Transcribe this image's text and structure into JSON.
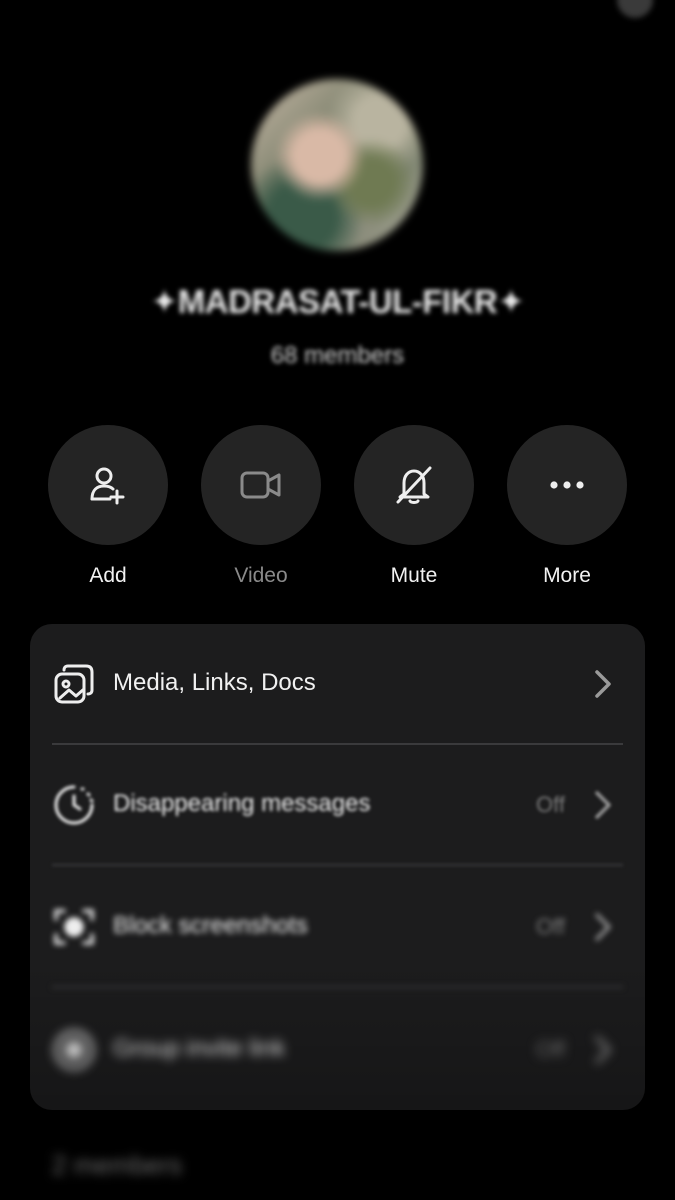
{
  "group": {
    "name": "✦MADRASAT-UL-FIKR✦",
    "members": "68 members"
  },
  "actions": [
    {
      "label": "Add",
      "icon": "add-person-icon"
    },
    {
      "label": "Video",
      "icon": "video-camera-icon"
    },
    {
      "label": "Mute",
      "icon": "bell-off-icon"
    },
    {
      "label": "More",
      "icon": "more-dots-icon"
    }
  ],
  "settings": [
    {
      "label": "Media, Links, Docs",
      "value": "",
      "icon": "media-gallery-icon"
    },
    {
      "label": "Disappearing messages",
      "value": "Off",
      "icon": "timer-icon"
    },
    {
      "label": "Block screenshots",
      "value": "Off",
      "icon": "screenshot-block-icon"
    },
    {
      "label": "Group invite link",
      "value": "Off",
      "icon": "link-icon"
    }
  ],
  "members_section": {
    "heading": "2 members"
  },
  "colors": {
    "background": "#000000",
    "card": "#1c1c1d",
    "action_circle": "#242424",
    "muted_text": "#7c7c7c"
  }
}
